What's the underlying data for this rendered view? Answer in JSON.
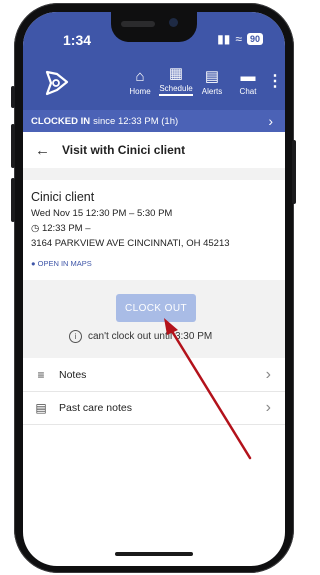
{
  "status": {
    "time": "1:34",
    "battery": "90"
  },
  "nav": {
    "items": [
      {
        "label": "Home",
        "icon": "home-icon",
        "glyph": "⌂"
      },
      {
        "label": "Schedule",
        "icon": "calendar-icon",
        "glyph": "▦"
      },
      {
        "label": "Alerts",
        "icon": "message-icon",
        "glyph": "▤"
      },
      {
        "label": "Chat",
        "icon": "chat-icon",
        "glyph": "▬"
      }
    ],
    "active": "Schedule"
  },
  "clocked": {
    "label": "CLOCKED IN",
    "detail": "since 12:33 PM (1h)"
  },
  "page": {
    "title": "Visit with Cinici client"
  },
  "visit": {
    "client": "Cinici client",
    "schedule": "Wed Nov 15  12:30 PM – 5:30 PM",
    "clock_in": "12:33 PM –",
    "address": "3164 PARKVIEW AVE CINCINNATI, OH 45213",
    "maps_link": "OPEN IN MAPS"
  },
  "clock_out": {
    "button": "CLOCK OUT",
    "message": "can't clock out until 3:30 PM"
  },
  "list": [
    {
      "label": "Notes",
      "icon": "notes-icon"
    },
    {
      "label": "Past care notes",
      "icon": "clipboard-icon"
    }
  ],
  "colors": {
    "brand": "#3f56a8",
    "annotation_arrow": "#b3121b"
  }
}
